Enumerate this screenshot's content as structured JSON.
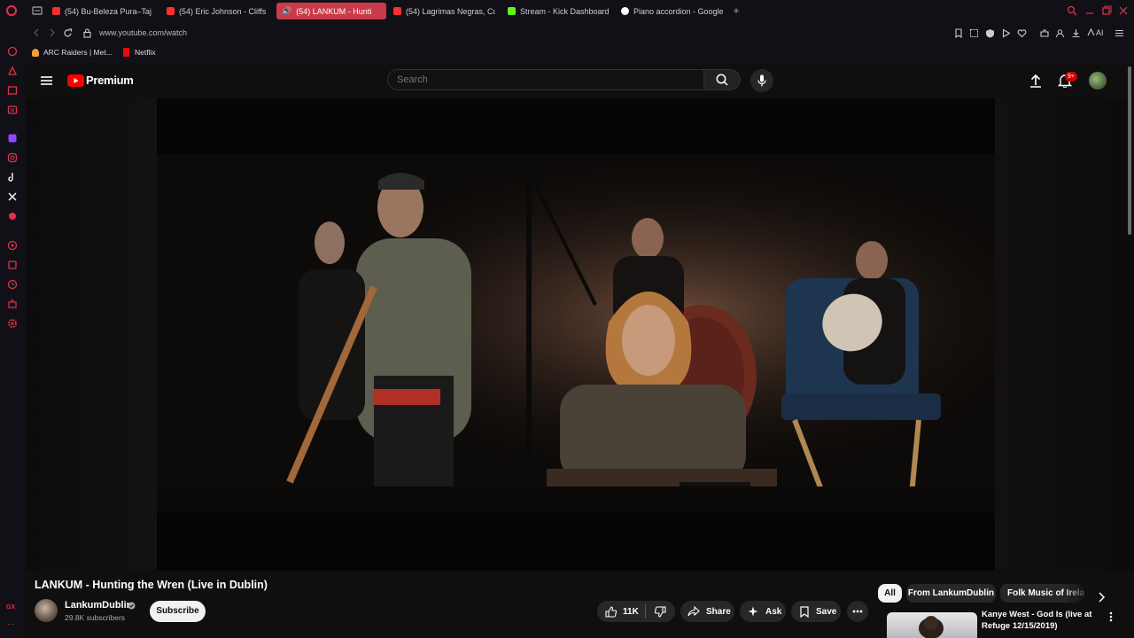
{
  "browser": {
    "tabs": [
      {
        "label": "(54) Bu-Beleza Pura–Taj",
        "fav_color": "#ff2e2e"
      },
      {
        "label": "(54) Eric Johnson - Cliffs",
        "fav_color": "#ff2e2e"
      },
      {
        "label": "(54) LANKUM - Hunti",
        "fav_color": "#ffffff"
      },
      {
        "label": "(54) Lagrimas Negras, Cu",
        "fav_color": "#ff2e2e"
      },
      {
        "label": "Stream - Kick Dashboard",
        "fav_color": "#53fc18"
      },
      {
        "label": "Piano accordion - Google",
        "fav_color": "#4285f4"
      }
    ],
    "url": "www.youtube.com/watch",
    "bookmarks": [
      {
        "label": "ARC Raiders | Met...",
        "fav_color": "#f0a030"
      },
      {
        "label": "Netflix",
        "fav_color": "#e50914"
      }
    ],
    "aria_label": "AI",
    "gx_label": "GX",
    "more_label": "···"
  },
  "youtube": {
    "logo_text": "Premium",
    "search_placeholder": "Search",
    "notification_badge": "9+",
    "video_title": "LANKUM - Hunting the Wren (Live in Dublin)",
    "channel_name": "LankumDublin",
    "subscribers": "29.8K subscribers",
    "subscribe_label": "Subscribe",
    "like_count": "11K",
    "share_label": "Share",
    "ask_label": "Ask",
    "save_label": "Save",
    "chips": [
      "All",
      "From LankumDublin",
      "Folk Music of Ireland"
    ],
    "recommended": [
      {
        "title": "Kanye West - God Is (live at Refuge 12/15/2019)"
      }
    ],
    "colors": {
      "brand_red": "#ff0000",
      "bg": "#0f0f0f",
      "pill": "#272727"
    }
  }
}
